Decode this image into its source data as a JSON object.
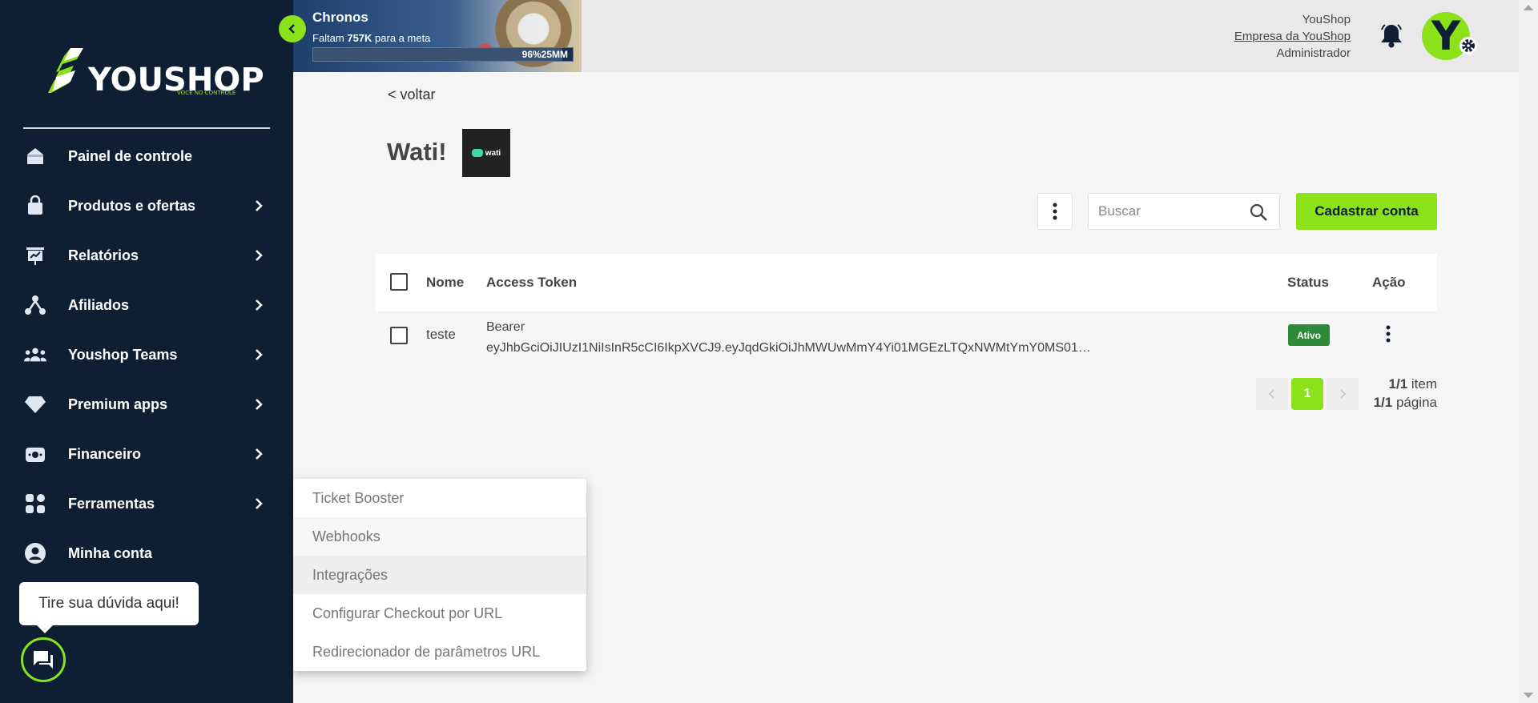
{
  "brand": {
    "logo_text": "YOUSHOP",
    "tagline": "VOCÊ NO CONTROLE"
  },
  "sidebar": {
    "items": [
      {
        "label": "Painel de controle",
        "icon": "home-icon"
      },
      {
        "label": "Produtos e ofertas",
        "icon": "bag-icon"
      },
      {
        "label": "Relatórios",
        "icon": "report-icon"
      },
      {
        "label": "Afiliados",
        "icon": "affiliates-icon"
      },
      {
        "label": "Youshop Teams",
        "icon": "teams-icon"
      },
      {
        "label": "Premium apps",
        "icon": "diamond-icon"
      },
      {
        "label": "Financeiro",
        "icon": "money-icon"
      },
      {
        "label": "Ferramentas",
        "icon": "tools-icon"
      },
      {
        "label": "Minha conta",
        "icon": "account-icon"
      }
    ]
  },
  "chat": {
    "tooltip": "Tire sua dúvida aqui!"
  },
  "banner": {
    "title": "Chronos",
    "sub_prefix": "Faltam ",
    "sub_amount": "757K",
    "sub_suffix": " para a meta",
    "progress_label": "96%25MM",
    "progress_fraction": 0.96
  },
  "user": {
    "name": "YouShop",
    "company": "Empresa da YouShop",
    "role": "Administrador",
    "avatar_letter": "Y"
  },
  "main": {
    "back_label": "< voltar",
    "title": "Wati!",
    "integration_logo_text": "wati",
    "search_placeholder": "Buscar",
    "cta_label": "Cadastrar conta"
  },
  "table": {
    "headers": {
      "name": "Nome",
      "token": "Access Token",
      "status": "Status",
      "action": "Ação"
    },
    "rows": [
      {
        "name": "teste",
        "token_line1": "Bearer",
        "token_line2": "eyJhbGciOiJIUzI1NiIsInR5cCI6IkpXVCJ9.eyJqdGkiOiJhMWUwMmY4Yi01MGEzLTQxNWMtYmY0MS01…",
        "status": "Ativo"
      }
    ]
  },
  "pagination": {
    "current_page": "1",
    "items_count": "1/1",
    "items_label": " item",
    "pages_count": "1/1",
    "pages_label": " página"
  },
  "dropdown": {
    "items": [
      "Ticket Booster",
      "Webhooks",
      "Integrações",
      "Configurar Checkout por URL",
      "Redirecionador de parâmetros URL"
    ]
  },
  "colors": {
    "sidebar": "#0e1f33",
    "accent": "#8be21a",
    "status_active": "#2c8a38"
  }
}
